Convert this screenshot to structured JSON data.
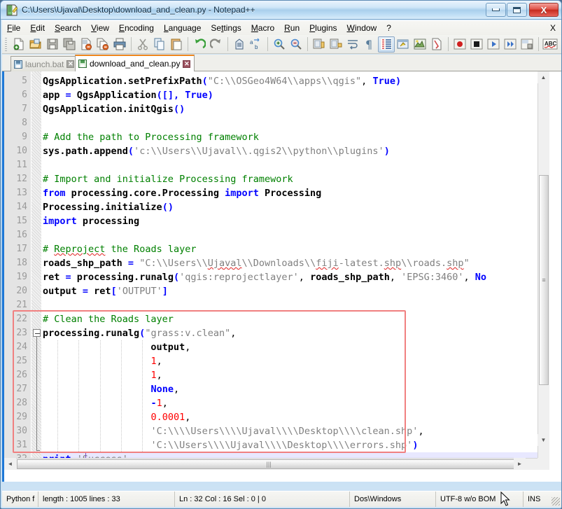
{
  "window": {
    "title": "C:\\Users\\Ujaval\\Desktop\\download_and_clean.py - Notepad++",
    "icon": "notepad-plus-plus-icon",
    "buttons": {
      "minimize": "minimize-icon",
      "maximize": "maximize-icon",
      "close": "X"
    }
  },
  "menubar": {
    "items": [
      {
        "label": "File",
        "mnemonic": "F"
      },
      {
        "label": "Edit",
        "mnemonic": "E"
      },
      {
        "label": "Search",
        "mnemonic": "S"
      },
      {
        "label": "View",
        "mnemonic": "V"
      },
      {
        "label": "Encoding",
        "mnemonic": "E"
      },
      {
        "label": "Language",
        "mnemonic": "L"
      },
      {
        "label": "Settings",
        "mnemonic": "t"
      },
      {
        "label": "Macro",
        "mnemonic": "M"
      },
      {
        "label": "Run",
        "mnemonic": "R"
      },
      {
        "label": "Plugins",
        "mnemonic": "P"
      },
      {
        "label": "Window",
        "mnemonic": "W"
      },
      {
        "label": "?",
        "mnemonic": ""
      }
    ],
    "close_document": "X"
  },
  "toolbar": {
    "buttons": [
      "new-file-icon",
      "open-file-icon",
      "save-icon",
      "save-all-icon",
      "close-file-icon",
      "close-all-files-icon",
      "print-icon",
      "cut-icon",
      "copy-icon",
      "paste-icon",
      "undo-icon",
      "redo-icon",
      "find-icon",
      "replace-icon",
      "zoom-in-icon",
      "zoom-out-icon",
      "sync-vertical-scroll-icon",
      "sync-horizontal-scroll-icon",
      "word-wrap-icon",
      "show-all-characters-icon",
      "indent-guide-icon",
      "user-defined-dialog-icon",
      "show-whitespace-icon",
      "document-map-icon",
      "record-macro-icon",
      "stop-recording-icon",
      "play-macro-icon",
      "play-macro-multiple-icon",
      "save-macro-icon",
      "spell-check-icon"
    ]
  },
  "tabs": [
    {
      "label": "launch.bat",
      "active": false,
      "icon": "saved-document-icon",
      "close": "x"
    },
    {
      "label": "download_and_clean.py",
      "active": true,
      "icon": "saved-document-icon",
      "close": "x"
    }
  ],
  "editor": {
    "first_visible_line": 5,
    "current_line": 32,
    "lines": [
      {
        "n": 5,
        "tokens": [
          {
            "t": "QgsApplication.setPrefixPath",
            "c": "bold"
          },
          {
            "t": "(",
            "c": "op"
          },
          {
            "t": "\"C:\\\\OSGeo4W64\\\\apps\\\\qgis\"",
            "c": "str"
          },
          {
            "t": ", ",
            "c": "id"
          },
          {
            "t": "True",
            "c": "kw"
          },
          {
            "t": ")",
            "c": "op"
          }
        ]
      },
      {
        "n": 6,
        "tokens": [
          {
            "t": "app ",
            "c": "bold"
          },
          {
            "t": "=",
            "c": "op"
          },
          {
            "t": " QgsApplication",
            "c": "bold"
          },
          {
            "t": "([], ",
            "c": "op"
          },
          {
            "t": "True",
            "c": "kw"
          },
          {
            "t": ")",
            "c": "op"
          }
        ]
      },
      {
        "n": 7,
        "tokens": [
          {
            "t": "QgsApplication.initQgis",
            "c": "bold"
          },
          {
            "t": "()",
            "c": "op"
          }
        ]
      },
      {
        "n": 8,
        "tokens": []
      },
      {
        "n": 9,
        "tokens": [
          {
            "t": "# Add the path to Processing framework",
            "c": "cm"
          }
        ]
      },
      {
        "n": 10,
        "tokens": [
          {
            "t": "sys.path.append",
            "c": "bold"
          },
          {
            "t": "(",
            "c": "op"
          },
          {
            "t": "'c:\\\\Users\\\\Ujaval\\\\.qgis2\\\\python\\\\plugins'",
            "c": "str"
          },
          {
            "t": ")",
            "c": "op"
          }
        ]
      },
      {
        "n": 11,
        "tokens": []
      },
      {
        "n": 12,
        "tokens": [
          {
            "t": "# Import and initialize Processing framework",
            "c": "cm"
          }
        ]
      },
      {
        "n": 13,
        "tokens": [
          {
            "t": "from",
            "c": "kw"
          },
          {
            "t": " processing.core.Processing ",
            "c": "bold"
          },
          {
            "t": "import",
            "c": "kw"
          },
          {
            "t": " Processing",
            "c": "bold"
          }
        ]
      },
      {
        "n": 14,
        "tokens": [
          {
            "t": "Processing.initialize",
            "c": "bold"
          },
          {
            "t": "()",
            "c": "op"
          }
        ]
      },
      {
        "n": 15,
        "tokens": [
          {
            "t": "import",
            "c": "kw"
          },
          {
            "t": " processing",
            "c": "bold"
          }
        ]
      },
      {
        "n": 16,
        "tokens": []
      },
      {
        "n": 17,
        "tokens": [
          {
            "t": "# ",
            "c": "cm"
          },
          {
            "t": "Reproject",
            "c": "cm sq"
          },
          {
            "t": " the Roads layer",
            "c": "cm"
          }
        ]
      },
      {
        "n": 18,
        "tokens": [
          {
            "t": "roads_shp_path ",
            "c": "bold"
          },
          {
            "t": "=",
            "c": "op"
          },
          {
            "t": " ",
            "c": "id"
          },
          {
            "t": "\"C:\\\\Users\\\\",
            "c": "str"
          },
          {
            "t": "Ujaval",
            "c": "str sq"
          },
          {
            "t": "\\\\Downloads\\\\",
            "c": "str"
          },
          {
            "t": "fiji",
            "c": "str sq"
          },
          {
            "t": "-latest.",
            "c": "str"
          },
          {
            "t": "shp",
            "c": "str sq"
          },
          {
            "t": "\\\\roads.",
            "c": "str"
          },
          {
            "t": "shp",
            "c": "str sq"
          },
          {
            "t": "\"",
            "c": "str"
          }
        ]
      },
      {
        "n": 19,
        "tokens": [
          {
            "t": "ret ",
            "c": "bold"
          },
          {
            "t": "=",
            "c": "op"
          },
          {
            "t": " processing.runalg",
            "c": "bold"
          },
          {
            "t": "(",
            "c": "op"
          },
          {
            "t": "'qgis:reprojectlayer'",
            "c": "str"
          },
          {
            "t": ", ",
            "c": "id"
          },
          {
            "t": "roads_shp_path",
            "c": "bold"
          },
          {
            "t": ", ",
            "c": "id"
          },
          {
            "t": "'EPSG:3460'",
            "c": "str"
          },
          {
            "t": ", ",
            "c": "id"
          },
          {
            "t": "No",
            "c": "kw"
          }
        ]
      },
      {
        "n": 20,
        "tokens": [
          {
            "t": "output ",
            "c": "bold"
          },
          {
            "t": "=",
            "c": "op"
          },
          {
            "t": " ret",
            "c": "bold"
          },
          {
            "t": "[",
            "c": "op"
          },
          {
            "t": "'OUTPUT'",
            "c": "str"
          },
          {
            "t": "]",
            "c": "op"
          }
        ]
      },
      {
        "n": 21,
        "tokens": []
      },
      {
        "n": 22,
        "tokens": [
          {
            "t": "# Clean the Roads layer",
            "c": "cm"
          }
        ]
      },
      {
        "n": 23,
        "tokens": [
          {
            "t": "processing.runalg",
            "c": "bold"
          },
          {
            "t": "(",
            "c": "op"
          },
          {
            "t": "\"grass:v.clean\"",
            "c": "str"
          },
          {
            "t": ",",
            "c": "id"
          }
        ]
      },
      {
        "n": 24,
        "tokens": [
          {
            "t": "                   output",
            "c": "bold"
          },
          {
            "t": ",",
            "c": "id"
          }
        ]
      },
      {
        "n": 25,
        "tokens": [
          {
            "t": "                   ",
            "c": "id"
          },
          {
            "t": "1",
            "c": "num"
          },
          {
            "t": ",",
            "c": "id"
          }
        ]
      },
      {
        "n": 26,
        "tokens": [
          {
            "t": "                   ",
            "c": "id"
          },
          {
            "t": "1",
            "c": "num"
          },
          {
            "t": ",",
            "c": "id"
          }
        ]
      },
      {
        "n": 27,
        "tokens": [
          {
            "t": "                   ",
            "c": "id"
          },
          {
            "t": "None",
            "c": "kw"
          },
          {
            "t": ",",
            "c": "id"
          }
        ]
      },
      {
        "n": 28,
        "tokens": [
          {
            "t": "                   ",
            "c": "id"
          },
          {
            "t": "-",
            "c": "op"
          },
          {
            "t": "1",
            "c": "num"
          },
          {
            "t": ",",
            "c": "id"
          }
        ]
      },
      {
        "n": 29,
        "tokens": [
          {
            "t": "                   ",
            "c": "id"
          },
          {
            "t": "0.0001",
            "c": "num"
          },
          {
            "t": ",",
            "c": "id"
          }
        ]
      },
      {
        "n": 30,
        "tokens": [
          {
            "t": "                   ",
            "c": "id"
          },
          {
            "t": "'C:\\\\\\\\Users\\\\\\\\Ujaval\\\\\\\\Desktop\\\\\\\\clean.shp'",
            "c": "str"
          },
          {
            "t": ",",
            "c": "id"
          }
        ]
      },
      {
        "n": 31,
        "tokens": [
          {
            "t": "                   ",
            "c": "id"
          },
          {
            "t": "'C:\\\\Users\\\\\\\\Ujaval\\\\\\\\Desktop\\\\\\\\errors.shp'",
            "c": "str"
          },
          {
            "t": ")",
            "c": "op"
          }
        ]
      },
      {
        "n": 32,
        "tokens": [
          {
            "t": "print",
            "c": "kw"
          },
          {
            "t": " ",
            "c": "id"
          },
          {
            "t": "'Success'",
            "c": "str"
          }
        ]
      }
    ],
    "annotation": {
      "shape": "rectangle",
      "color": "#f08080",
      "from_line": 22,
      "to_line": 31
    },
    "fold": {
      "marker_line": 23,
      "collapsed": false
    }
  },
  "scrollbars": {
    "vertical_up": "▲",
    "vertical_down": "▼",
    "horizontal_left": "◄",
    "horizontal_right": "►",
    "thumb_grip": "≡"
  },
  "statusbar": {
    "language": "Python f",
    "length_lines": "length : 1005   lines : 33",
    "position": "Ln : 32   Col : 16   Sel : 0 | 0",
    "eol": "Dos\\Windows",
    "encoding": "UTF-8 w/o BOM",
    "insert_mode": "INS"
  },
  "colors": {
    "keyword": "#0000ff",
    "comment": "#008000",
    "string": "#808080",
    "number": "#ff0000",
    "annotation": "#f08080",
    "active_tab_accent": "#f0861b",
    "editor_border": "#1e78d7",
    "current_line": "#e8e8ff"
  }
}
